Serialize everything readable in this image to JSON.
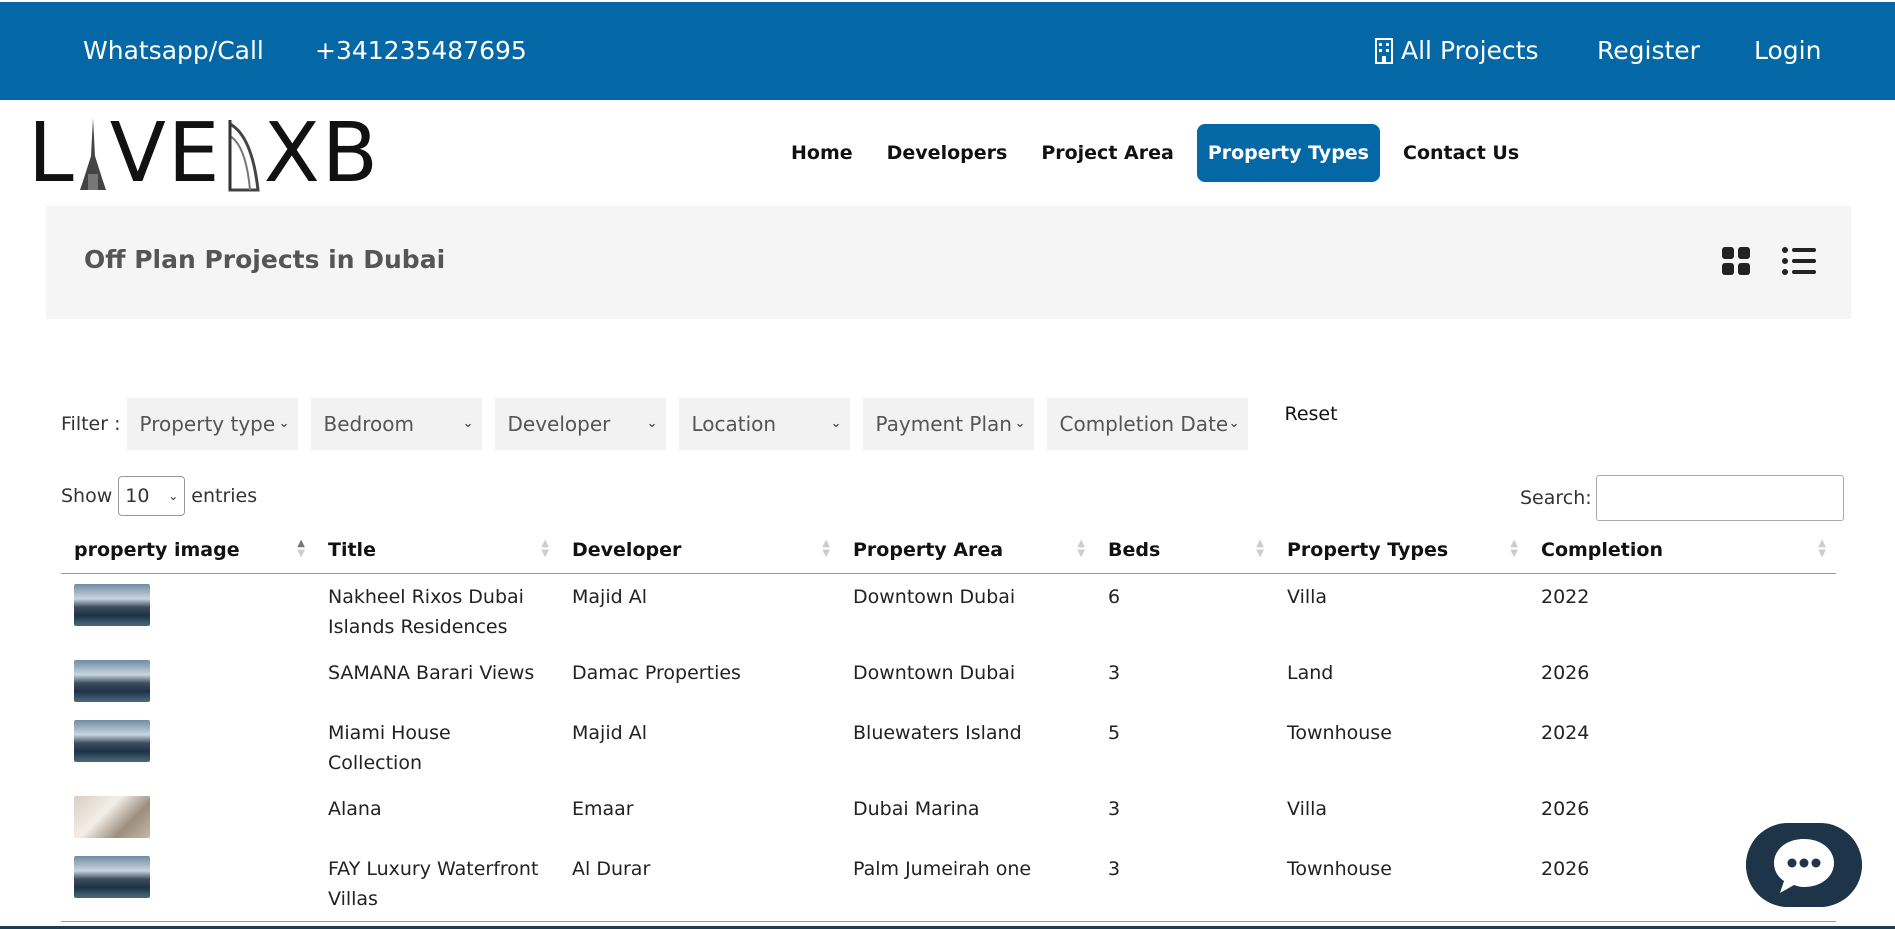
{
  "topbar": {
    "phone_label": "Whatsapp/Call",
    "phone": "+341235487695",
    "all_projects": "All Projects",
    "register": "Register",
    "login": "Login",
    "bg_color": "#0568a6"
  },
  "logo": {
    "left": "L",
    "mid": "VE",
    "right": "XB"
  },
  "nav": {
    "home": "Home",
    "developers": "Developers",
    "project_area": "Project Area",
    "property_types": "Property Types",
    "contact_us": "Contact Us",
    "active": "Property Types"
  },
  "banner": {
    "title": "Off Plan Projects in Dubai"
  },
  "filter": {
    "label": "Filter :",
    "selects": [
      "Property type",
      "Bedroom",
      "Developer",
      "Location",
      "Payment Plan",
      "Completion Date"
    ],
    "reset": "Reset"
  },
  "table_controls": {
    "show": "Show",
    "entries_value": "10",
    "entries": "entries",
    "search_label": "Search:",
    "search_value": ""
  },
  "table": {
    "headers": [
      "property image",
      "Title",
      "Developer",
      "Property Area",
      "Beds",
      "Property Types",
      "Completion"
    ],
    "rows": [
      {
        "image": "pool",
        "title": "Nakheel Rixos Dubai Islands Residences",
        "developer": "Majid Al",
        "area": "Downtown Dubai",
        "beds": "6",
        "type": "Villa",
        "completion": "2022"
      },
      {
        "image": "pool",
        "title": "SAMANA Barari Views",
        "developer": "Damac Properties",
        "area": "Downtown Dubai",
        "beds": "3",
        "type": "Land",
        "completion": "2026"
      },
      {
        "image": "pool",
        "title": "Miami House Collection",
        "developer": "Majid Al",
        "area": "Bluewaters Island",
        "beds": "5",
        "type": "Townhouse",
        "completion": "2024"
      },
      {
        "image": "room",
        "title": "Alana",
        "developer": "Emaar",
        "area": "Dubai Marina",
        "beds": "3",
        "type": "Villa",
        "completion": "2026"
      },
      {
        "image": "pool",
        "title": "FAY Luxury Waterfront Villas",
        "developer": "Al Durar",
        "area": "Palm Jumeirah one",
        "beds": "3",
        "type": "Townhouse",
        "completion": "2026"
      }
    ]
  },
  "icons": {
    "building": "building-icon",
    "grid_view": "grid-view-icon",
    "list_view": "list-view-icon",
    "chat": "chat-bubble-icon"
  }
}
